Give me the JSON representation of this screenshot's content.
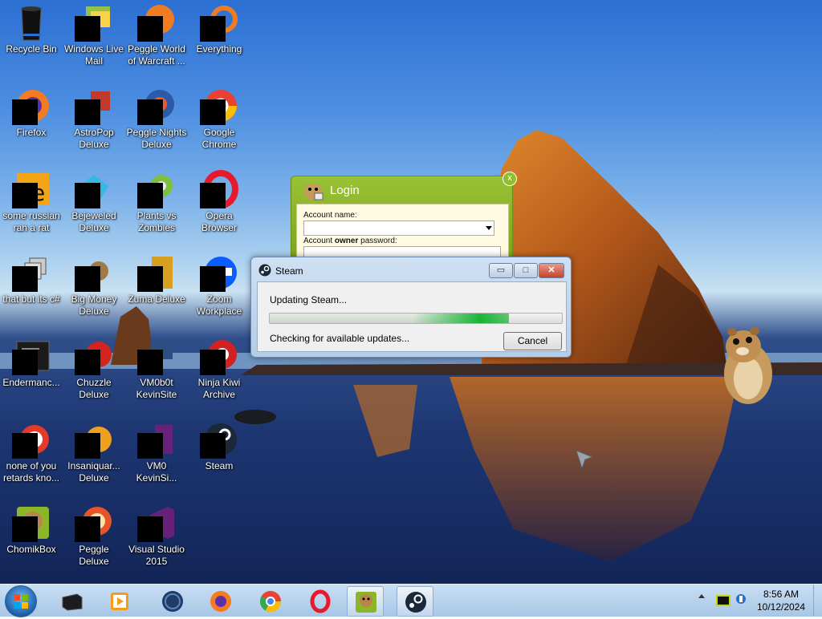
{
  "desktop": {
    "icons": [
      {
        "label": "Recycle Bin"
      },
      {
        "label": "Windows Live Mail"
      },
      {
        "label": "Peggle World of Warcraft ..."
      },
      {
        "label": "Everything"
      },
      {
        "label": "Firefox"
      },
      {
        "label": "AstroPop Deluxe"
      },
      {
        "label": "Peggle Nights Deluxe"
      },
      {
        "label": "Google Chrome"
      },
      {
        "label": "some russian ran a rat"
      },
      {
        "label": "Bejeweled Deluxe"
      },
      {
        "label": "Plants vs Zombies"
      },
      {
        "label": "Opera Browser"
      },
      {
        "label": "that but its c#"
      },
      {
        "label": "Big Money Deluxe"
      },
      {
        "label": "Zuma Deluxe"
      },
      {
        "label": "Zoom Workplace"
      },
      {
        "label": "Endermanc..."
      },
      {
        "label": "Chuzzle Deluxe"
      },
      {
        "label": "VM0b0t KevinSite"
      },
      {
        "label": "Ninja Kiwi Archive"
      },
      {
        "label": "none of you retards kno..."
      },
      {
        "label": "Insaniquar... Deluxe"
      },
      {
        "label": "VM0 KevinSi..."
      },
      {
        "label": "Steam"
      },
      {
        "label": "ChomikBox"
      },
      {
        "label": "Peggle Deluxe"
      },
      {
        "label": "Visual Studio 2015"
      }
    ]
  },
  "login_window": {
    "title": "Login",
    "account_name_label": "Account name:",
    "password_label_pre": "Account ",
    "password_label_bold": "owner",
    "password_label_post": " password:",
    "close_glyph": "x"
  },
  "steam_window": {
    "title": "Steam",
    "status_main": "Updating Steam...",
    "status_sub": "Checking for available updates...",
    "cancel_label": "Cancel",
    "progress_fraction": 0.82
  },
  "taskbar": {
    "apps": [
      "steam-legacy-icon",
      "media-player-icon",
      "app-globe-icon",
      "firefox-icon",
      "chrome-icon",
      "opera-icon",
      "chomikbox-icon",
      "steam-icon"
    ],
    "clock_time": "8:56 AM",
    "clock_date": "10/12/2024"
  },
  "colors": {
    "login_green": "#8cb62a",
    "steam_progress_green": "#06b025"
  }
}
